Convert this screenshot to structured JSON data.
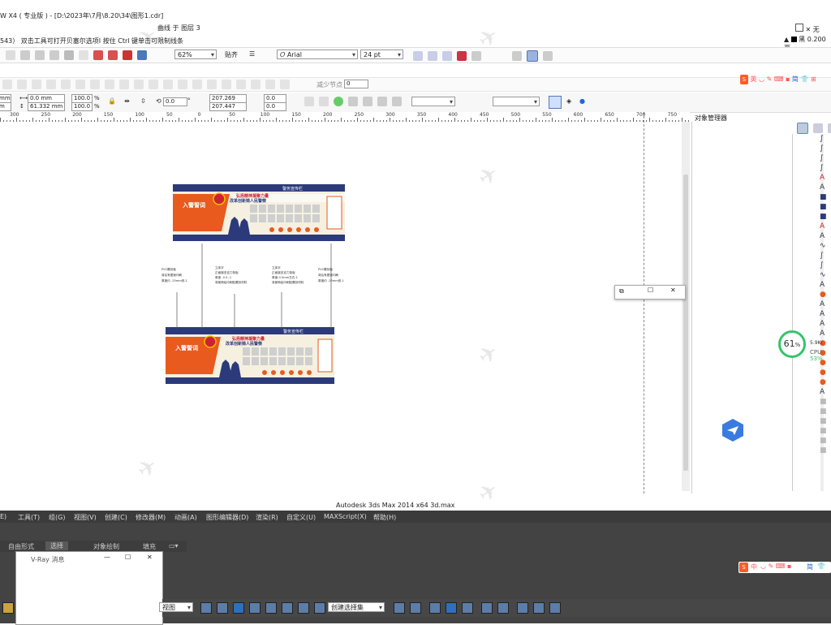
{
  "title": "W X4 ( 专业版 ) - [D:\\2023年\\7月\\8.20\\34\\图形1.cdr]",
  "status_subtitle": "曲线 于 图层 3",
  "hint": "543）  双击工具可打开贝塞尔选项I  按住 Ctrl 键单击可限制线条",
  "fill": {
    "label": "无"
  },
  "outline": {
    "label": "黑 0.200 毫"
  },
  "toolbar": {
    "zoom": "62%",
    "snap_label": "贴齐",
    "font": "Arial",
    "size": "24 pt"
  },
  "node_bar": {
    "label": "减少节点",
    "value": "0"
  },
  "props": {
    "x1": "0.0 mm",
    "y1": "61.332 mm",
    "sx": "100.0",
    "sy": "100.0",
    "pct": "%",
    "rot": "0.0",
    "deg": "°",
    "w": "207.269 mm",
    "h": "207.447 mm",
    "a1": "0.0",
    "a2": "0.0",
    "x_label": "mm",
    "y_label": "m"
  },
  "ruler": [
    "300",
    "250",
    "200",
    "150",
    "100",
    "50",
    "0",
    "50",
    "100",
    "150",
    "200",
    "250",
    "300",
    "350",
    "400",
    "450",
    "500",
    "550",
    "600",
    "650",
    "700",
    "750"
  ],
  "object_manager": {
    "title": "对象管理器"
  },
  "cpu": {
    "percent": "61",
    "unit": "%",
    "label": "CPU",
    "value": "53%",
    "speed": "5.9K/"
  },
  "design": {
    "top_header": "警务宣传栏",
    "top_left_title": "入警誓词",
    "top_slogan1": "弘扬精神凝聚力量",
    "top_slogan2": "改革创新铸人民警察",
    "bottom_header": "警务宣传栏",
    "bottom_left_title": "入警誓词",
    "bottom_slogan1": "弘扬精神凝聚力量",
    "bottom_slogan2": "改革创新铸人民警察",
    "notes": [
      [
        "PVC雕刻板",
        "背后有图案印刷",
        "厚度约 -25mm底-1"
      ],
      [
        "立体字",
        "正面镀亚克力背板",
        "厚度 -0.5--1",
        "背景喷绘印刷贴雕刻材料"
      ],
      [
        "立体字",
        "正面镀亚克力背板",
        "厚度-0.5mm左右-1",
        "背景喷绘印刷贴雕刻材料"
      ],
      [
        "PVC雕刻板",
        "背后有图案印刷",
        "厚度约 -25mm底-1"
      ]
    ]
  },
  "max": {
    "title": "Autodesk 3ds Max  2014 x64      3d.max",
    "menus": [
      "E)",
      "工具(T)",
      "组(G)",
      "视图(V)",
      "创建(C)",
      "修改器(M)",
      "动画(A)",
      "图形编辑器(D)",
      "渲染(R)",
      "自定义(U)",
      "MAXScript(X)",
      "帮助(H)"
    ],
    "tabs": [
      "自由形式",
      "选择",
      "对象绘制",
      "填充"
    ],
    "vray_title": "V-Ray 消息",
    "view_select": "视图",
    "set_select": "创建选择集"
  },
  "ime": {
    "chars": [
      "中",
      "简"
    ]
  },
  "colors": {
    "brand_orange": "#e85a1e",
    "navy": "#2b3a7a",
    "cpu_green": "#36c46b"
  }
}
